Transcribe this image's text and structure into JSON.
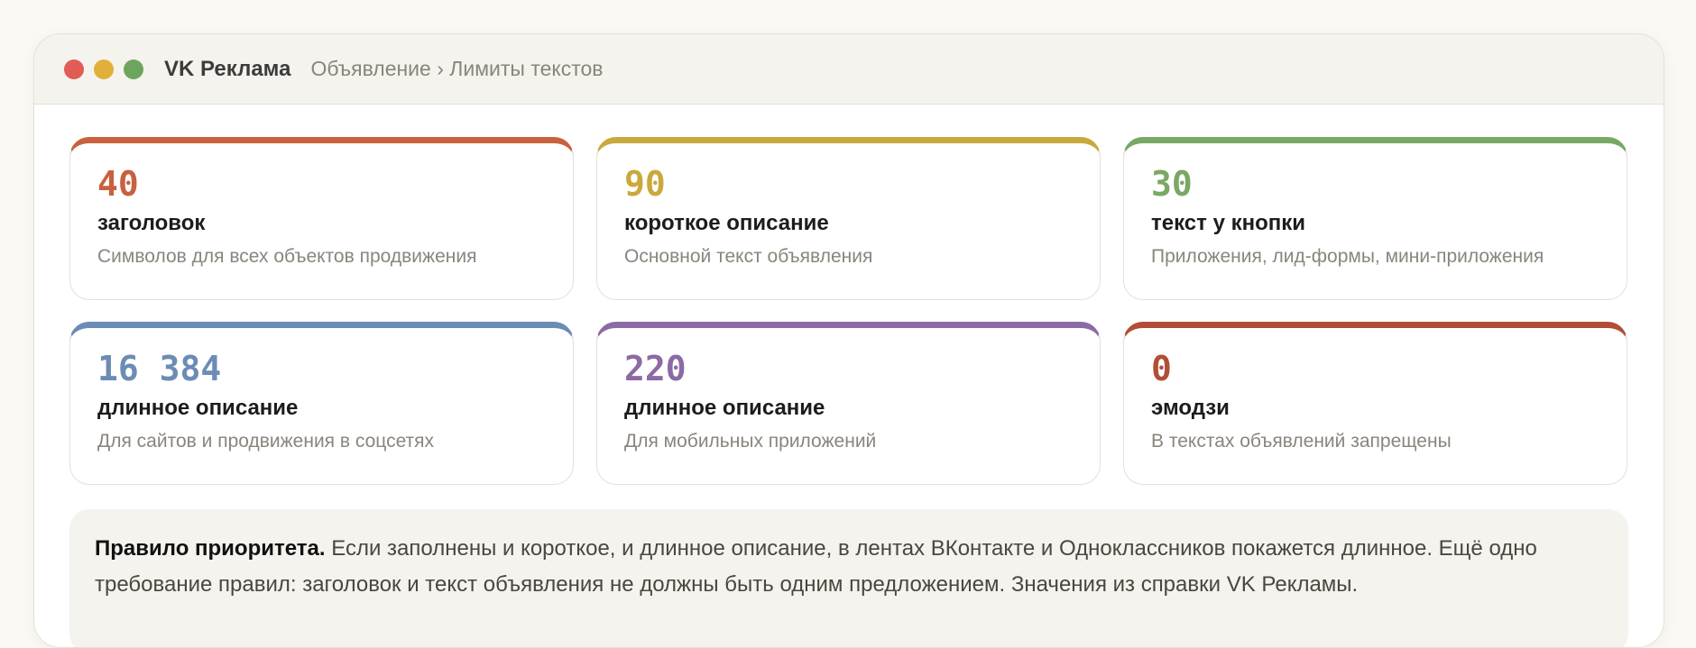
{
  "window": {
    "dots": [
      {
        "name": "close-dot",
        "color": "#e05d56"
      },
      {
        "name": "minimize-dot",
        "color": "#e2b03a"
      },
      {
        "name": "maximize-dot",
        "color": "#6ea55c"
      }
    ],
    "title": "VK Реклама",
    "breadcrumb": "Объявление › Лимиты текстов"
  },
  "cards": [
    {
      "number": "40",
      "label": "заголовок",
      "desc": "Символов для всех объектов продвижения",
      "accent": "#c8613f"
    },
    {
      "number": "90",
      "label": "короткое описание",
      "desc": "Основной текст объявления",
      "accent": "#c9a93c"
    },
    {
      "number": "30",
      "label": "текст у кнопки",
      "desc": "Приложения, лид-формы, мини-приложения",
      "accent": "#79a865"
    },
    {
      "number": "16 384",
      "label": "длинное описание",
      "desc": "Для сайтов и продвижения в соцсетях",
      "accent": "#6b8cb5"
    },
    {
      "number": "220",
      "label": "длинное описание",
      "desc": "Для мобильных приложений",
      "accent": "#8c6aa3"
    },
    {
      "number": "0",
      "label": "эмодзи",
      "desc": "В текстах объявлений запрещены",
      "accent": "#b24e36"
    }
  ],
  "note": {
    "bold": "Правило приоритета.",
    "text": " Если заполнены и короткое, и длинное описание, в лентах ВКонтакте и Одноклассников покажется длинное. Ещё одно требование правил: заголовок и текст объявления не должны быть одним предложением. Значения из справки VK Рекламы."
  }
}
